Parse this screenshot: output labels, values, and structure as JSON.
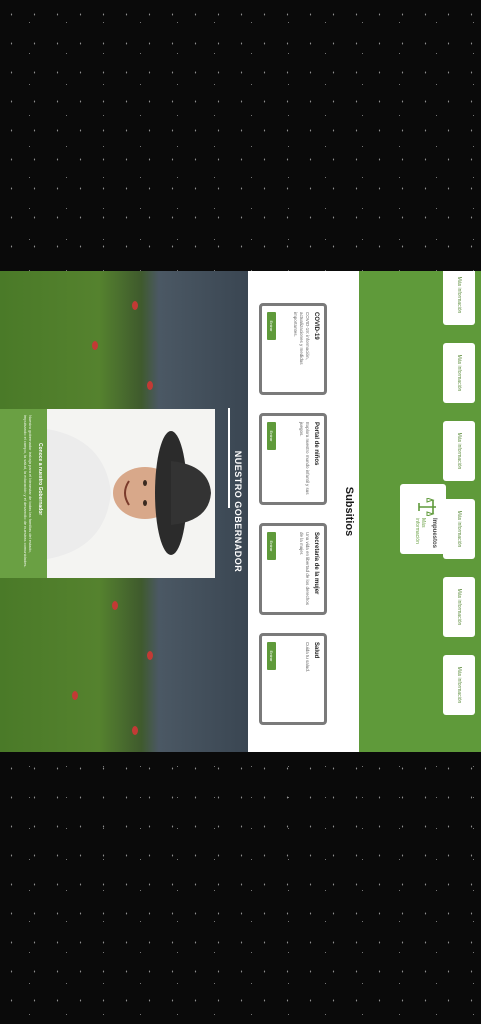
{
  "links": [
    {
      "label": "Más información"
    },
    {
      "label": "Más información"
    },
    {
      "label": "Más información"
    },
    {
      "label": "Más información"
    },
    {
      "label": "Más información"
    },
    {
      "label": "Más información"
    }
  ],
  "featured": {
    "title": "Impuestos",
    "subtitle": "Más información"
  },
  "subsitios": {
    "title": "Subsitios",
    "cards": [
      {
        "title": "COVID-19",
        "description": "COVID-19: información, actualizaciones y medidas importantes.",
        "button": "Entrar"
      },
      {
        "title": "Portal de niños",
        "description": "Explora nuestro mundo infantil y sus juegos.",
        "button": "Entrar"
      },
      {
        "title": "Secretaría de la mujer",
        "description": "Una vida en libertad de los derechos de la mujer.",
        "button": "Entrar"
      },
      {
        "title": "Salud",
        "description": "Cuida tu salud.",
        "button": "Entrar"
      }
    ]
  },
  "governor": {
    "heading": "NUESTRO GOBERNADOR",
    "name": "Conoce a nuestro Gobernador",
    "bio": "Nuestro gobernador trabaja para el bienestar de todas las familias del estado, impulsando el campo, la salud, la educación y el desarrollo de nuestras comunidades."
  },
  "colors": {
    "brand_green": "#5f9a3a",
    "accent_green": "#6aa043",
    "card_border": "#7a7a7a"
  }
}
